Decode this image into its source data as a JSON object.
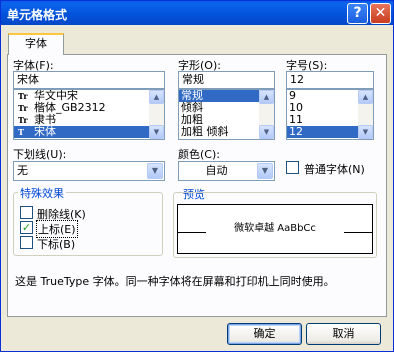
{
  "window": {
    "title": "单元格格式",
    "help_glyph": "?",
    "close_glyph": "✕"
  },
  "tab": {
    "label": "字体"
  },
  "font": {
    "label": "字体(F):",
    "value": "宋体",
    "items": [
      {
        "icon": "Tr",
        "name": "华文中宋",
        "selected": false
      },
      {
        "icon": "Tr",
        "name": "楷体_GB2312",
        "selected": false
      },
      {
        "icon": "Tr",
        "name": "隶书",
        "selected": false
      },
      {
        "icon": "T",
        "name": "宋体",
        "selected": true
      }
    ]
  },
  "style": {
    "label": "字形(O):",
    "value": "常规",
    "items": [
      {
        "name": "常规",
        "selected": true
      },
      {
        "name": "倾斜",
        "selected": false
      },
      {
        "name": "加粗",
        "selected": false
      },
      {
        "name": "加粗 倾斜",
        "selected": false
      }
    ]
  },
  "size": {
    "label": "字号(S):",
    "value": "12",
    "items": [
      {
        "name": "9",
        "selected": false
      },
      {
        "name": "10",
        "selected": false
      },
      {
        "name": "11",
        "selected": false
      },
      {
        "name": "12",
        "selected": true
      }
    ]
  },
  "underline": {
    "label": "下划线(U):",
    "value": "无"
  },
  "color": {
    "label": "颜色(C):",
    "value": "自动"
  },
  "normal_font": {
    "label": "普通字体(N)",
    "checked": false
  },
  "effects": {
    "title": "特殊效果",
    "strikethrough": {
      "label": "删除线(K)",
      "checked": false
    },
    "superscript": {
      "label": "上标(E)",
      "checked": true,
      "check_glyph": "✓"
    },
    "subscript": {
      "label": "下标(B)",
      "checked": false
    }
  },
  "preview": {
    "title": "预览",
    "text": "微软卓越 AaBbCc"
  },
  "note": "这是 TrueType 字体。同一种字体将在屏幕和打印机上同时使用。",
  "buttons": {
    "ok": "确定",
    "cancel": "取消"
  },
  "icons": {
    "scroll_up": "▲",
    "scroll_down": "▼",
    "dropdown": "▼"
  }
}
